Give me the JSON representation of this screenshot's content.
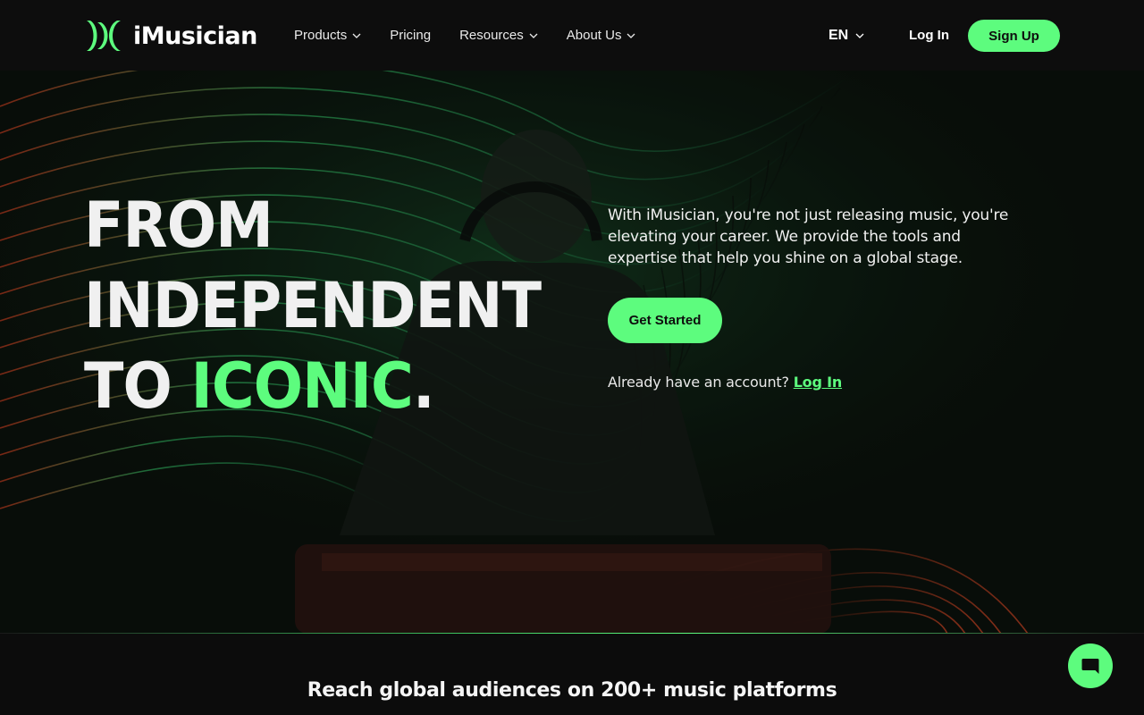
{
  "brand": {
    "name": "iMusician",
    "accent": "#5dfc7e",
    "logo_icon": "imusician-logo-icon"
  },
  "nav": {
    "items": [
      {
        "label": "Products",
        "has_dropdown": true
      },
      {
        "label": "Pricing",
        "has_dropdown": false
      },
      {
        "label": "Resources",
        "has_dropdown": true
      },
      {
        "label": "About Us",
        "has_dropdown": true
      }
    ],
    "language": "EN",
    "login_label": "Log In",
    "signup_label": "Sign Up"
  },
  "hero": {
    "headline_line1": "FROM",
    "headline_line2": "INDEPENDENT",
    "headline_line3_prefix": "TO ",
    "headline_line3_accent": "ICONIC",
    "headline_line3_suffix": ".",
    "description": "With iMusician, you're not just releasing music, you're elevating your career. We provide the tools and expertise that help you shine on a global stage.",
    "cta_label": "Get Started",
    "account_prompt": "Already have an account?",
    "account_login_label": "Log In"
  },
  "section": {
    "reach_title": "Reach global audiences on 200+ music platforms"
  },
  "chat": {
    "icon": "chat-bubble-icon"
  }
}
